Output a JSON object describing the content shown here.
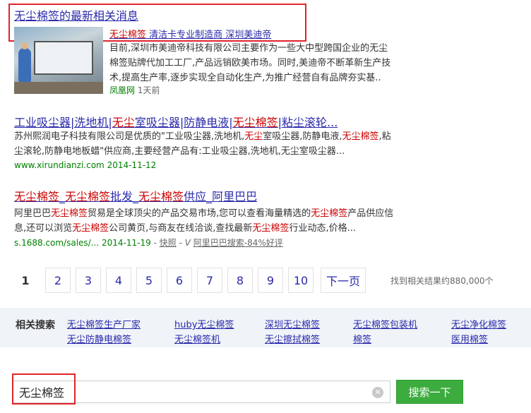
{
  "news": {
    "title": "无尘棉签的最新相关消息",
    "sub_link_1": "无尘棉签",
    "sub_link_2": "清洁卡专业制造商",
    "sub_link_3": "深圳美迪帝",
    "snippet_line1": "目前,深圳市美迪帝科技有限公司主要作为一些大中型跨国企业的无尘",
    "snippet_line2": "棉签贴牌代加工工厂,产品远销欧美市场。同时,美迪帝不断革新生产技",
    "snippet_line3": "术,提高生产率,逐步实现全自动化生产,为推广经营自有品牌夯实基..",
    "source": "凤凰网",
    "time": "1天前"
  },
  "results": [
    {
      "title_parts": [
        "工业吸尘器|洗地机|",
        "无尘",
        "室吸尘器|防静电液|",
        "无尘棉签",
        "|粘尘滚轮..."
      ],
      "snippet_line1_parts": [
        "苏州熙润电子科技有限公司是优质的\"工业吸尘器,洗地机,",
        "无尘",
        "室吸尘器,防静电液,",
        "无尘棉签",
        ",粘"
      ],
      "snippet_line2": "尘滚轮,防静电地板蜡\"供应商,主要经营产品有:工业吸尘器,洗地机,无尘室吸尘器...",
      "url": "www.xirundianzi.com",
      "date": "2014-11-12"
    },
    {
      "title_parts": [
        "无尘棉签",
        "_",
        "无尘棉签",
        "批发_",
        "无尘棉签",
        "供应_阿里巴巴"
      ],
      "snippet_line1_parts": [
        "阿里巴巴",
        "无尘棉签",
        "贸易是全球顶尖的产品交易市场,您可以查看海量精选的",
        "无尘棉签",
        "产品供应信"
      ],
      "snippet_line2_parts": [
        "息,还可以浏览",
        "无尘棉签",
        "公司黄页,与商友在线洽谈,查找最新",
        "无尘棉签",
        "行业动态,价格..."
      ],
      "url": "s.1688.com/sales/...",
      "date": "2014-11-19",
      "snapshot": "快照",
      "rating": "阿里巴巴搜索-84%好评"
    }
  ],
  "pagination": {
    "pages": [
      "1",
      "2",
      "3",
      "4",
      "5",
      "6",
      "7",
      "8",
      "9",
      "10"
    ],
    "current": "1",
    "next": "下一页",
    "count_text": "找到相关结果约880,000个"
  },
  "related": {
    "label": "相关搜索",
    "links": [
      "无尘棉签生产厂家",
      "huby无尘棉签",
      "深圳无尘棉签",
      "无尘棉签包装机",
      "无尘净化棉签",
      "无尘防静电棉签",
      "无尘棉签机",
      "无尘擦拭棉签",
      "棉签",
      "医用棉签"
    ]
  },
  "search": {
    "value": "无尘棉签",
    "button": "搜索一下"
  },
  "colors": {
    "link": "#2a2aac",
    "keyword": "#cc0000",
    "url": "#008000",
    "button": "#3cac3e",
    "highlight_box": "#e0242b"
  }
}
